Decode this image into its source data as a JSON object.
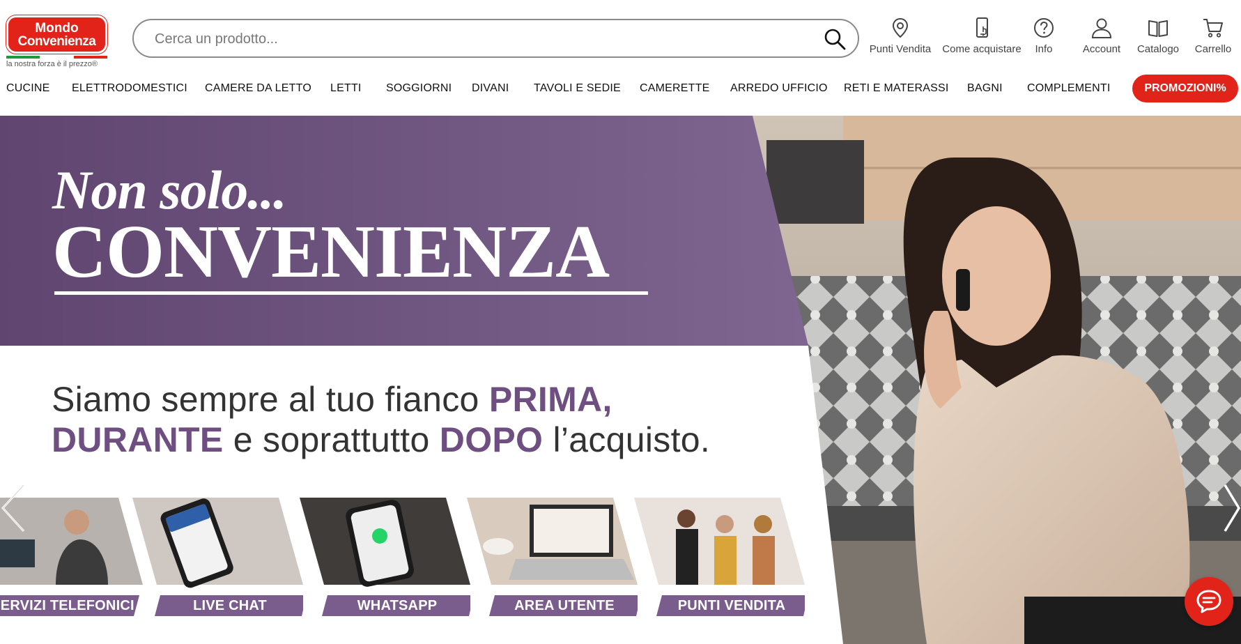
{
  "brand": {
    "logo_line1": "Mondo",
    "logo_line2": "Convenienza",
    "tagline": "la nostra forza è il prezzo®",
    "red": "#e2231a",
    "purple": "#6f4f82"
  },
  "search": {
    "placeholder": "Cerca un prodotto...",
    "icon": "search-icon"
  },
  "header_links": [
    {
      "label": "Punti Vendita",
      "icon": "map-pin-icon"
    },
    {
      "label": "Come acquistare",
      "icon": "phone-tap-icon"
    },
    {
      "label": "Info",
      "icon": "help-circle-icon"
    },
    {
      "label": "Account",
      "icon": "user-icon"
    },
    {
      "label": "Catalogo",
      "icon": "book-icon"
    },
    {
      "label": "Carrello",
      "icon": "cart-icon"
    }
  ],
  "nav": {
    "items": [
      "CUCINE",
      "ELETTRODOMESTICI",
      "CAMERE DA LETTO",
      "LETTI",
      "SOGGIORNI",
      "DIVANI",
      "TAVOLI E SEDIE",
      "CAMERETTE",
      "ARREDO UFFICIO",
      "RETI E MATERASSI",
      "BAGNI",
      "COMPLEMENTI"
    ],
    "promo_label": "PROMOZIONI%"
  },
  "hero": {
    "title_line1": "Non solo...",
    "title_line2": "CONVENIENZA",
    "sub_line1": {
      "a": "Siamo sempre al tuo fianco ",
      "b": "PRIMA,"
    },
    "sub_line2": {
      "a": "DURANTE",
      "b": " e soprattutto ",
      "c": "DOPO",
      "d": " l’acquisto."
    },
    "tiles": [
      "SERVIZI TELEFONICI",
      "LIVE CHAT",
      "WHATSAPP",
      "AREA UTENTE",
      "PUNTI VENDITA"
    ],
    "prev_icon": "chevron-left-icon",
    "next_icon": "chevron-right-icon"
  },
  "chat": {
    "icon": "chat-bubble-icon"
  }
}
